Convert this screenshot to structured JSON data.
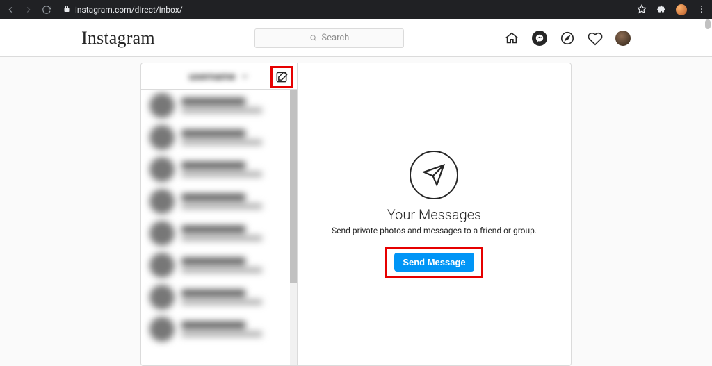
{
  "browser": {
    "url": "instagram.com/direct/inbox/"
  },
  "nav": {
    "logo_text": "Instagram",
    "search_placeholder": "Search"
  },
  "inbox": {
    "header_username": "username",
    "compose_label": "New message",
    "threads": [
      {
        "name": "contact",
        "preview": "message preview"
      },
      {
        "name": "contact",
        "preview": "message preview"
      },
      {
        "name": "contact",
        "preview": "message preview"
      },
      {
        "name": "contact",
        "preview": "message preview"
      },
      {
        "name": "contact",
        "preview": "message preview"
      },
      {
        "name": "contact",
        "preview": "message preview"
      },
      {
        "name": "contact",
        "preview": "message preview"
      },
      {
        "name": "contact",
        "preview": "message preview"
      }
    ]
  },
  "empty_state": {
    "title": "Your Messages",
    "subtitle": "Send private photos and messages to a friend or group.",
    "button_label": "Send Message"
  }
}
